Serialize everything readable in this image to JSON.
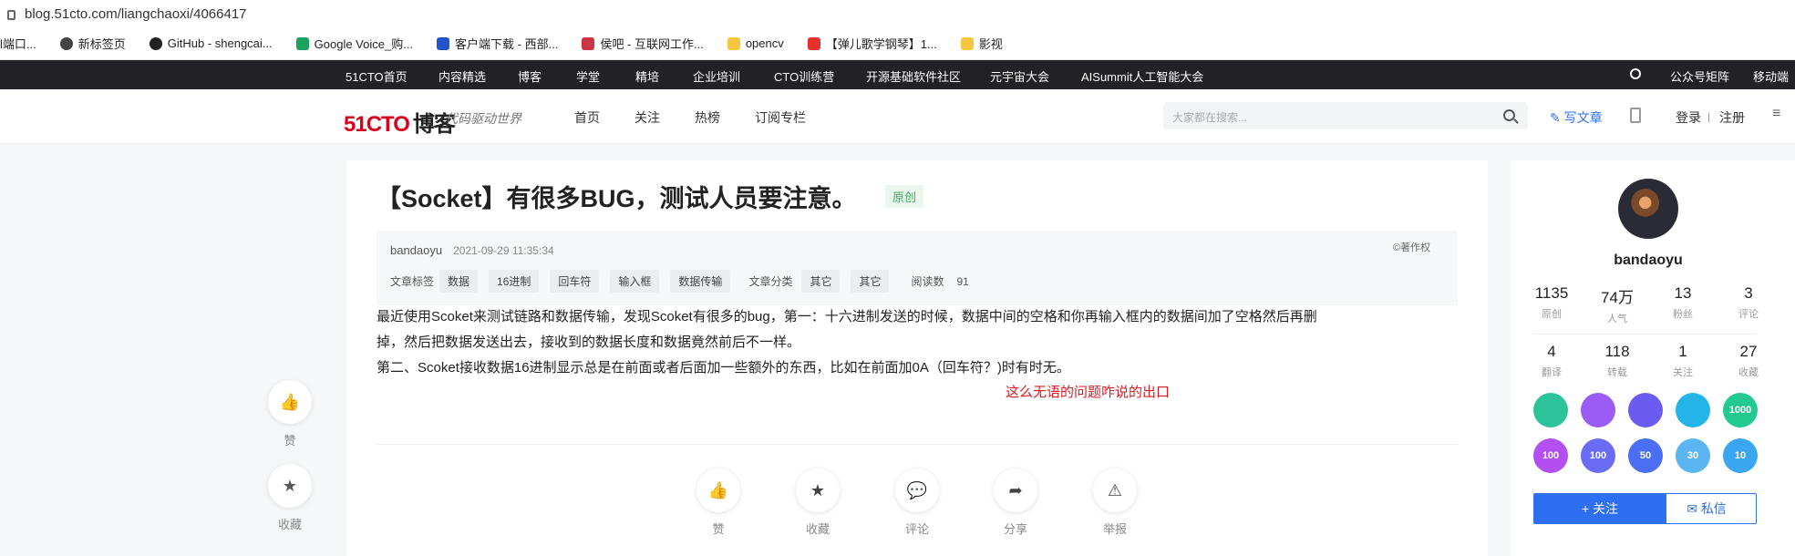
{
  "browser": {
    "url": "blog.51cto.com/liangchaoxi/4066417",
    "bookmarks": [
      {
        "label": "l端口...",
        "icon": "folder-icon",
        "color": "#f5c542"
      },
      {
        "label": "新标签页",
        "icon": "globe-icon",
        "color": "#444"
      },
      {
        "label": "GitHub - shengcai...",
        "icon": "github-icon",
        "color": "#222"
      },
      {
        "label": "Google Voice_购...",
        "icon": "translate-icon",
        "color": "#1aa260"
      },
      {
        "label": "客户端下载 - 西部...",
        "icon": "w-icon",
        "color": "#2255cc"
      },
      {
        "label": "侯吧 - 互联网工作...",
        "icon": "bookmark-icon",
        "color": "#cc3344"
      },
      {
        "label": "opencv",
        "icon": "folder-icon",
        "color": "#f5c542"
      },
      {
        "label": "【弹儿歌学钢琴】1...",
        "icon": "listen-icon",
        "color": "#e8312c"
      },
      {
        "label": "影视",
        "icon": "folder-icon",
        "color": "#f5c542"
      }
    ]
  },
  "topnav": {
    "items": [
      "51CTO首页",
      "内容精选",
      "博客",
      "学堂",
      "精培",
      "企业培训",
      "CTO训练营",
      "开源基础软件社区",
      "元宇宙大会",
      "AISummit人工智能大会"
    ],
    "right": [
      "公众号矩阵",
      "移动端"
    ]
  },
  "header": {
    "logo_main": "51CTO",
    "logo_blog": "博客",
    "slogan": "代码驱动世界",
    "nav": [
      "首页",
      "关注",
      "热榜",
      "订阅专栏"
    ],
    "search_placeholder": "大家都在搜索...",
    "write": "写文章",
    "login": "登录",
    "divider": "|",
    "register": "注册"
  },
  "article": {
    "title": "【Socket】有很多BUG，测试人员要注意。",
    "badge": "原创",
    "author": "bandaoyu",
    "date": "2021-09-29 11:35:34",
    "copyright": "©著作权",
    "tags_label": "文章标签",
    "tags": [
      "数据",
      "16进制",
      "回车符",
      "输入框",
      "数据传输"
    ],
    "category_label": "文章分类",
    "categories": [
      "其它",
      "其它"
    ],
    "reads_label": "阅读数",
    "reads": "91",
    "para1": "最近使用Scoket来测试链路和数据传输，发现Scoket有很多的bug，第一：十六进制发送的时候，数据中间的空格和你再输入框内的数据间加了空格然后再删",
    "para1b": "掉，然后把数据发送出去，接收到的数据长度和数据竟然前后不一样。",
    "para2": "第二、Scoket接收数据16进制显示总是在前面或者后面加一些额外的东西，比如在前面加0A（回车符？)时有时无。",
    "red_text": "这么无语的问题咋说的出口",
    "actions": [
      "赞",
      "收藏",
      "评论",
      "分享",
      "举报"
    ]
  },
  "float_left": [
    "赞",
    "收藏"
  ],
  "sidebar": {
    "username": "bandaoyu",
    "stats": [
      {
        "n": "1135",
        "l": "原创"
      },
      {
        "n": "74万",
        "l": "人气"
      },
      {
        "n": "13",
        "l": "粉丝"
      },
      {
        "n": "3",
        "l": "评论"
      },
      {
        "n": "4",
        "l": "翻译"
      },
      {
        "n": "118",
        "l": "转载"
      },
      {
        "n": "1",
        "l": "关注"
      },
      {
        "n": "27",
        "l": "收藏"
      }
    ],
    "badges": [
      {
        "t": "",
        "c": "#2cc39a"
      },
      {
        "t": "",
        "c": "#9b5cf5"
      },
      {
        "t": "",
        "c": "#6a5cf0"
      },
      {
        "t": "",
        "c": "#24b4e8"
      },
      {
        "t": "1000",
        "c": "#23c98f"
      },
      {
        "t": "100",
        "c": "#b34ef0"
      },
      {
        "t": "100",
        "c": "#6a6cf5"
      },
      {
        "t": "50",
        "c": "#4a6ff5"
      },
      {
        "t": "30",
        "c": "#5bb5f0"
      },
      {
        "t": "10",
        "c": "#3aa6f0"
      }
    ],
    "follow": "+ 关注",
    "message": "私信"
  }
}
